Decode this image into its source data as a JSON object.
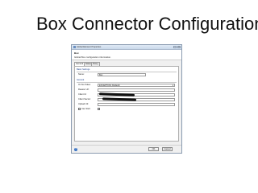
{
  "slide": {
    "title": "Box Connector Configuration"
  },
  "dialog": {
    "title": "Global Element Properties",
    "connector_name": "Box",
    "description": "Global Box configuration information.",
    "tabs": [
      {
        "label": "General"
      },
      {
        "label": "Notes"
      },
      {
        "label": "Proxy"
      }
    ],
    "basic_settings": {
      "heading": "Basic Settings",
      "name_label": "Name:",
      "name_value": "Box"
    },
    "general": {
      "heading": "General",
      "on_no_token_label": "On No Token:",
      "on_no_token_value": "EXCEPTION (Default)",
      "reason_label": "Reason Url:",
      "client_id_label": "Client Id:",
      "client_secret_label": "Client Secret:",
      "upload_url_label": "Upload Url:",
      "use_stub_label": "Use Stub:"
    },
    "buttons": {
      "ok": "OK",
      "cancel": "Cancel",
      "help": "?"
    },
    "title_buttons": {
      "minimize": "-",
      "close": "x"
    }
  }
}
